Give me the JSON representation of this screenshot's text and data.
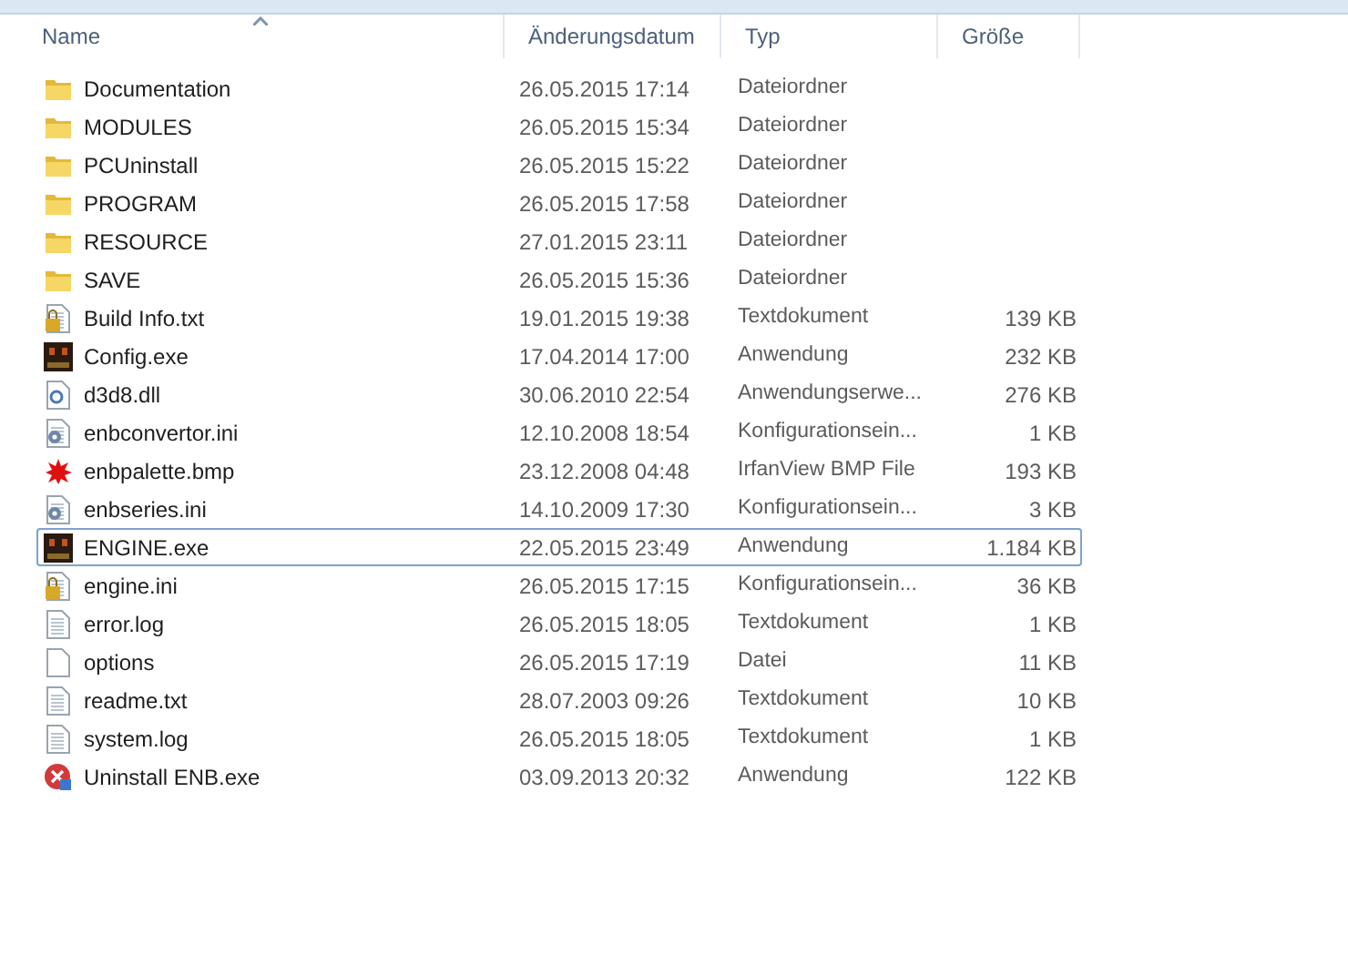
{
  "columns": [
    {
      "label": "Name",
      "sorted": true
    },
    {
      "label": "Änderungsdatum",
      "sorted": false
    },
    {
      "label": "Typ",
      "sorted": false
    },
    {
      "label": "Größe",
      "sorted": false
    }
  ],
  "files": [
    {
      "name": "Documentation",
      "date": "26.05.2015 17:14",
      "type": "Dateiordner",
      "kind": "folder",
      "selected": false
    },
    {
      "name": "MODULES",
      "date": "26.05.2015 15:34",
      "type": "Dateiordner",
      "kind": "folder",
      "selected": false
    },
    {
      "name": "PCUninstall",
      "date": "26.05.2015 15:22",
      "type": "Dateiordner",
      "kind": "folder",
      "selected": false
    },
    {
      "name": "PROGRAM",
      "date": "26.05.2015 17:58",
      "type": "Dateiordner",
      "kind": "folder",
      "selected": false
    },
    {
      "name": "RESOURCE",
      "date": "27.01.2015 23:11",
      "type": "Dateiordner",
      "kind": "folder",
      "selected": false
    },
    {
      "name": "SAVE",
      "date": "26.05.2015 15:36",
      "type": "Dateiordner",
      "kind": "folder",
      "selected": false
    },
    {
      "name": "Build Info.txt",
      "date": "19.01.2015 19:38",
      "type": "Textdokument",
      "size": "139 KB",
      "kind": "locked",
      "selected": false
    },
    {
      "name": "Config.exe",
      "date": "17.04.2014 17:00",
      "type": "Anwendung",
      "size": "232 KB",
      "kind": "app",
      "selected": false
    },
    {
      "name": "d3d8.dll",
      "date": "30.06.2010 22:54",
      "type": "Anwendungserwe...",
      "size": "276 KB",
      "kind": "dll",
      "selected": false
    },
    {
      "name": "enbconvertor.ini",
      "date": "12.10.2008 18:54",
      "type": "Konfigurationsein...",
      "size": "1 KB",
      "kind": "config",
      "selected": false
    },
    {
      "name": "enbpalette.bmp",
      "date": "23.12.2008 04:48",
      "type": "IrfanView BMP File",
      "size": "193 KB",
      "kind": "image",
      "selected": false
    },
    {
      "name": "enbseries.ini",
      "date": "14.10.2009 17:30",
      "type": "Konfigurationsein...",
      "size": "3 KB",
      "kind": "config",
      "selected": false
    },
    {
      "name": "ENGINE.exe",
      "date": "22.05.2015 23:49",
      "type": "Anwendung",
      "size": "1.184 KB",
      "kind": "app",
      "selected": true
    },
    {
      "name": "engine.ini",
      "date": "26.05.2015 17:15",
      "type": "Konfigurationsein...",
      "size": "36 KB",
      "kind": "locked",
      "selected": false
    },
    {
      "name": "error.log",
      "date": "26.05.2015 18:05",
      "type": "Textdokument",
      "size": "1 KB",
      "kind": "text",
      "selected": false
    },
    {
      "name": "options",
      "date": "26.05.2015 17:19",
      "type": "Datei",
      "size": "11 KB",
      "kind": "blank",
      "selected": false
    },
    {
      "name": "readme.txt",
      "date": "28.07.2003 09:26",
      "type": "Textdokument",
      "size": "10 KB",
      "kind": "text",
      "selected": false
    },
    {
      "name": "system.log",
      "date": "26.05.2015 18:05",
      "type": "Textdokument",
      "size": "1 KB",
      "kind": "text",
      "selected": false
    },
    {
      "name": "Uninstall ENB.exe",
      "date": "03.09.2013 20:32",
      "type": "Anwendung",
      "size": "122 KB",
      "kind": "uninstall",
      "selected": false
    }
  ]
}
